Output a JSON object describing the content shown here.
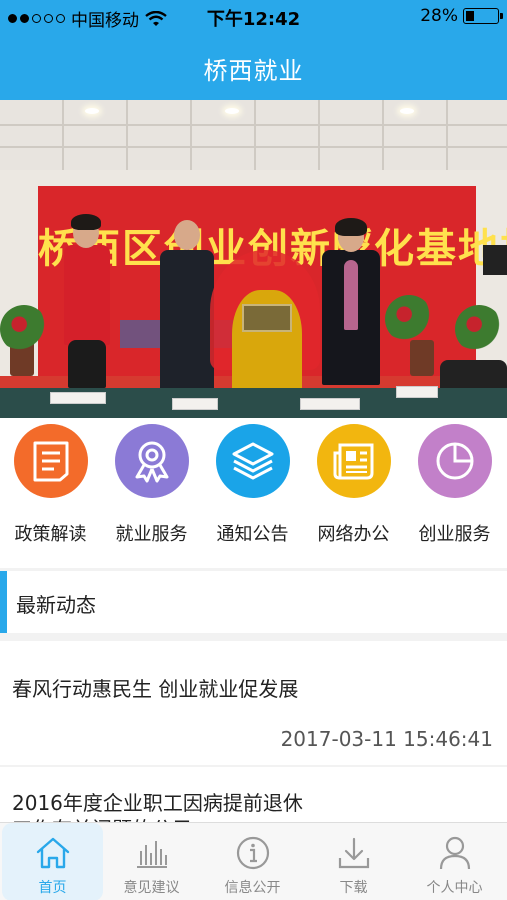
{
  "status": {
    "carrier": "中国移动",
    "time": "下午12:42",
    "battery": "28%",
    "battery_level": 0.28
  },
  "nav": {
    "title": "桥西就业"
  },
  "banner": {
    "slogan": "桥西区创业创新孵化基地揭牌仪式",
    "slide_count": 5,
    "active_slide": 2
  },
  "menu": {
    "items": [
      {
        "label": "政策解读",
        "icon": "document-icon",
        "color": "#f36b2a"
      },
      {
        "label": "就业服务",
        "icon": "award-ribbon-icon",
        "color": "#8b7ad6"
      },
      {
        "label": "通知公告",
        "icon": "layers-icon",
        "color": "#1aa4e8"
      },
      {
        "label": "网络办公",
        "icon": "newspaper-icon",
        "color": "#f2b60f"
      },
      {
        "label": "创业服务",
        "icon": "pie-chart-icon",
        "color": "#c280c9"
      }
    ]
  },
  "section": {
    "title": "最新动态"
  },
  "news": [
    {
      "title": "春风行动惠民生  创业就业促发展",
      "date": "2017-03-11 15:46:41"
    },
    {
      "title": "2016年度企业职工因病提前退休",
      "title_line2": "工作有关问题的公示"
    }
  ],
  "tabs": [
    {
      "label": "首页",
      "icon": "home-icon"
    },
    {
      "label": "意见建议",
      "icon": "bar-chart-icon"
    },
    {
      "label": "信息公开",
      "icon": "info-icon"
    },
    {
      "label": "下载",
      "icon": "download-icon"
    },
    {
      "label": "个人中心",
      "icon": "user-icon"
    }
  ],
  "colors": {
    "primary": "#29a8ea",
    "active_tab_bg": "#e4f2fb"
  }
}
